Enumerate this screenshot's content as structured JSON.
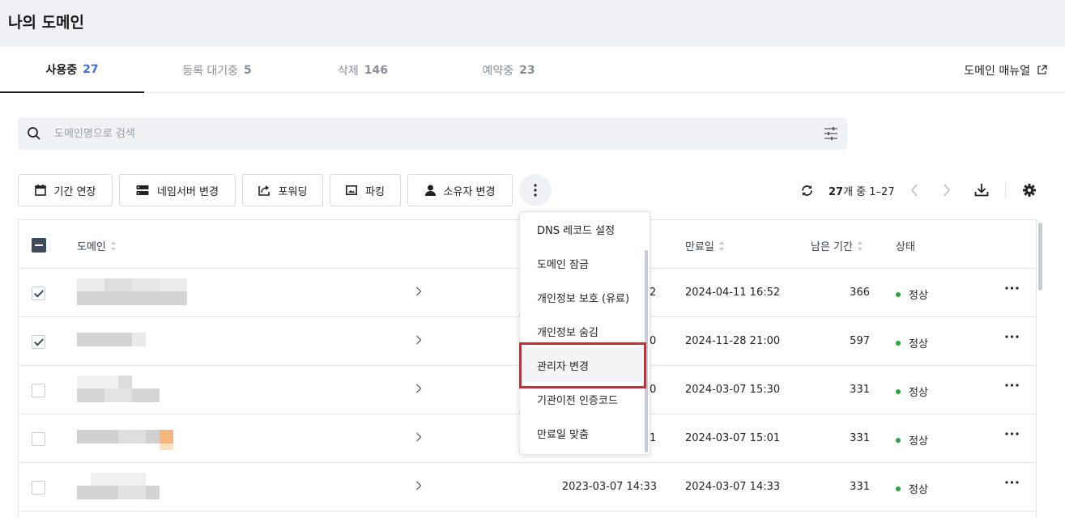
{
  "page": {
    "title": "나의 도메인"
  },
  "tabs": [
    {
      "label": "사용중",
      "count": "27",
      "active": true
    },
    {
      "label": "등록 대기중",
      "count": "5"
    },
    {
      "label": "삭제",
      "count": "146"
    },
    {
      "label": "예약중",
      "count": "23"
    }
  ],
  "manual_link": {
    "label": "도메인 매뉴얼",
    "icon": "external-link-icon"
  },
  "search": {
    "placeholder": "도메인명으로 검색",
    "value": ""
  },
  "toolbar": {
    "buttons": [
      {
        "label": "기간 연장",
        "icon": "calendar-icon"
      },
      {
        "label": "네임서버 변경",
        "icon": "server-icon"
      },
      {
        "label": "포워딩",
        "icon": "forward-icon"
      },
      {
        "label": "파킹",
        "icon": "image-icon"
      },
      {
        "label": "소유자 변경",
        "icon": "person-icon"
      }
    ],
    "more_icon": "vertical-dots-icon"
  },
  "pagination": {
    "total": "27",
    "text": "개 중 1–27"
  },
  "table": {
    "columns": {
      "domain": "도메인",
      "expiry": "만료일",
      "remaining": "남은 기간",
      "status": "상태"
    },
    "rows": [
      {
        "checked": true,
        "registered": "2",
        "expiry": "2024-04-11 16:52",
        "remaining": "366",
        "status": "정상"
      },
      {
        "checked": true,
        "registered": "0",
        "expiry": "2024-11-28 21:00",
        "remaining": "597",
        "status": "정상"
      },
      {
        "checked": false,
        "registered": "0",
        "expiry": "2024-03-07 15:30",
        "remaining": "331",
        "status": "정상"
      },
      {
        "checked": false,
        "registered": "1",
        "expiry": "2024-03-07 15:01",
        "remaining": "331",
        "status": "정상"
      },
      {
        "checked": false,
        "registered": "2023-03-07 14:33",
        "expiry": "2024-03-07 14:33",
        "remaining": "331",
        "status": "정상"
      }
    ]
  },
  "dropdown": {
    "items": [
      {
        "label": "DNS 레코드 설정"
      },
      {
        "label": "도메인 잠금"
      },
      {
        "label": "개인정보 보호 (유료)"
      },
      {
        "label": "개인정보 숨김"
      },
      {
        "label": "관리자 변경",
        "highlighted": true
      },
      {
        "label": "기관이전 인증코드"
      },
      {
        "label": "만료일 맞춤"
      }
    ]
  },
  "colors": {
    "accent": "#3b6ff5",
    "status_ok": "#2aa43a",
    "highlight_box": "#e3232b",
    "header_bg": "#eff1f4"
  }
}
